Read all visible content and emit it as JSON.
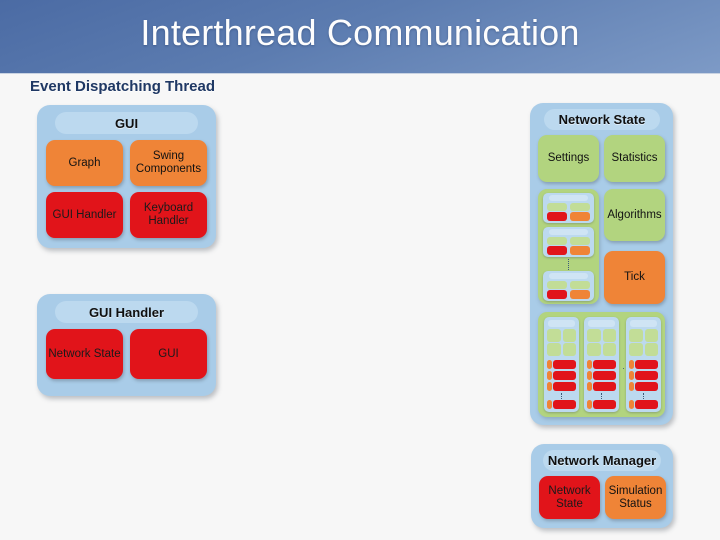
{
  "header": {
    "title": "Interthread Communication",
    "gradient_from": "#4b6ba4",
    "gradient_to": "#7d9ac6"
  },
  "section": {
    "label": "Event Dispatching Thread"
  },
  "palette": {
    "container_blue": "#a9cce8",
    "pill_blue": "#bcd9ef",
    "green": "#b2d47f",
    "orange": "#ef8437",
    "red": "#e1141a",
    "background": "#f7f7f7",
    "title_text": "#fdfdfd",
    "label_text": "#1f3864"
  },
  "groups": [
    {
      "id": "gui",
      "title": "GUI",
      "nodes": [
        {
          "label": "Graph",
          "color": "orange"
        },
        {
          "label": "Swing Components",
          "color": "orange"
        },
        {
          "label": "GUI Handler",
          "color": "red"
        },
        {
          "label": "Keyboard Handler",
          "color": "red"
        }
      ]
    },
    {
      "id": "gui-handler",
      "title": "GUI Handler",
      "nodes": [
        {
          "label": "Network State",
          "color": "red"
        },
        {
          "label": "GUI",
          "color": "red"
        }
      ]
    },
    {
      "id": "network-state",
      "title": "Network State",
      "nodes": [
        {
          "label": "Settings",
          "color": "green"
        },
        {
          "label": "Statistics",
          "color": "green"
        },
        {
          "label": "Algorithms",
          "color": "green"
        },
        {
          "label": "Tick",
          "color": "orange"
        }
      ]
    },
    {
      "id": "network-manager",
      "title": "Network Manager",
      "nodes": [
        {
          "label": "Network State",
          "color": "red"
        },
        {
          "label": "Simulation Status",
          "color": "orange"
        }
      ]
    }
  ],
  "nested": {
    "node_column": {
      "ellipsis": "⋮",
      "items": [
        {
          "cells": [
            "",
            "",
            "",
            ""
          ]
        },
        {
          "cells": [
            "",
            "",
            "",
            ""
          ]
        },
        {
          "cells": [
            "",
            "",
            "",
            ""
          ]
        }
      ]
    },
    "link_columns": {
      "ellipsis": "· · · ·",
      "count": 3
    }
  }
}
